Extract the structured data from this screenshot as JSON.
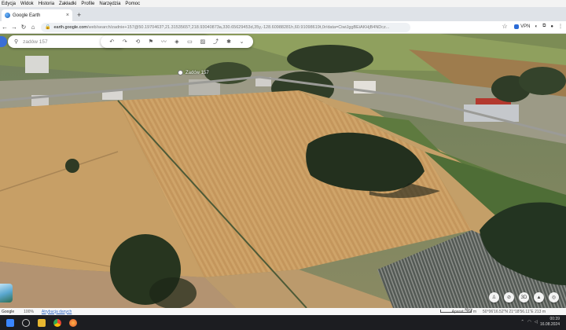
{
  "menu": [
    "Edycja",
    "Widok",
    "Historia",
    "Zakładki",
    "Profile",
    "Narzędzia",
    "Pomoc"
  ],
  "tab": {
    "title": "Google Earth",
    "close": "×"
  },
  "newtab": "+",
  "url": {
    "host": "earth.google.com",
    "path": "/web/search/zadnie+157@50.1970463?,21.3153565?,218.93040873a,330.65629453d,35y,-128.60988281h,60.91098619t,0r/data=CiwiJggBEiAKHjB4NDcz..."
  },
  "toolbar": {
    "vpn_label": "VPN"
  },
  "search": {
    "placeholder": "zadów 157"
  },
  "place_label": "Zadów 157",
  "controls": {
    "view_3d": "3D"
  },
  "status": {
    "brand": "Google",
    "note": "100%",
    "attribution": "Atrybucja danych",
    "camera": "Aparat: 364 m",
    "coords": "50°06'16.52\"N 21°18'56.11\"E  213 m",
    "scale_label": "20 m"
  },
  "clock": {
    "time": "00:39",
    "date": "16.08.2024"
  },
  "colors": {
    "accent": "#1a73e8",
    "taskbar": "#1c1d21"
  }
}
